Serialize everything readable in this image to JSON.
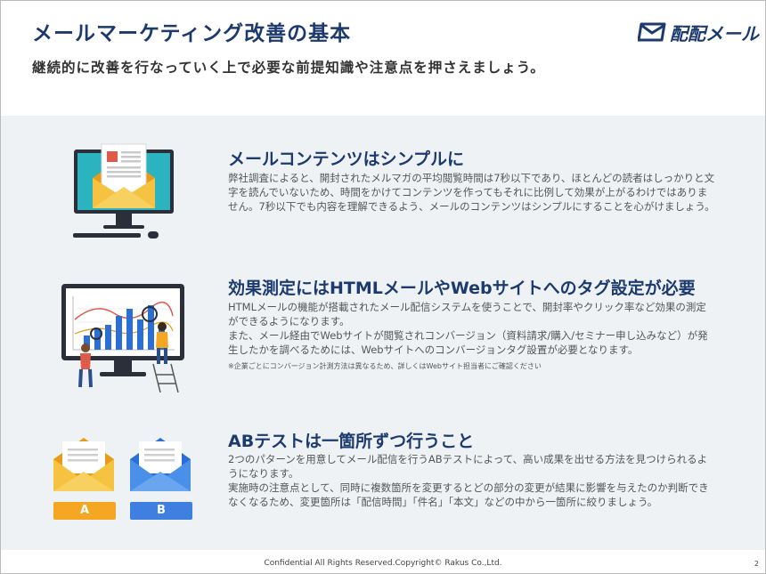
{
  "header": {
    "title": "メールマーケティング改善の基本",
    "subtitle": "継続的に改善を行なっていく上で必要な前提知識や注意点を押さえましょう。",
    "logo_text": "配配メール"
  },
  "sections": [
    {
      "title": "メールコンテンツはシンプルに",
      "body": "弊社調査によると、開封されたメルマガの平均閲覧時間は7秒以下であり、ほとんどの読者はしっかりと文字を読んでいないため、時間をかけてコンテンツを作ってもそれに比例して効果が上がるわけではありません。7秒以下でも内容を理解できるよう、メールのコンテンツはシンプルにすることを心がけましょう。",
      "illustration": "monitor-envelope-icon"
    },
    {
      "title": "効果測定にはHTMLメールやWebサイトへのタグ設定が必要",
      "body_1": "HTMLメールの機能が搭載されたメール配信システムを使うことで、開封率やクリック率など効果の測定ができるようになります。",
      "body_2": "また、メール経由でWebサイトが閲覧されコンバージョン（資料請求/購入/セミナー申し込みなど）が発生したかを調べるためには、Webサイトへのコンバージョンタグ設置が必要となります。",
      "note": "※企業ごとにコンバージョン計測方法は異なるため、詳しくはWebサイト担当者にご確認ください",
      "illustration": "analytics-chart-icon"
    },
    {
      "title": "ABテストは一箇所ずつ行うこと",
      "body_1": "2つのパターンを用意してメール配信を行うABテストによって、高い成果を出せる方法を見つけられるようになります。",
      "body_2": "実施時の注意点として、同時に複数箇所を変更するとどの部分の変更が結果に影響を与えたのか判断できなくなるため、変更箇所は「配信時間」「件名」「本文」などの中から一箇所に絞りましょう。",
      "label_a": "A",
      "label_b": "B",
      "illustration": "ab-envelopes-icon"
    }
  ],
  "footer": {
    "copyright": "Confidential All Rights Reserved.Copyright© Rakus Co.,Ltd.",
    "page_number": "2"
  },
  "colors": {
    "title": "#1c3a6e",
    "content_bg": "#eef2f5",
    "orange": "#f5a623",
    "blue": "#3f7fe0",
    "teal": "#2bb3c0"
  }
}
